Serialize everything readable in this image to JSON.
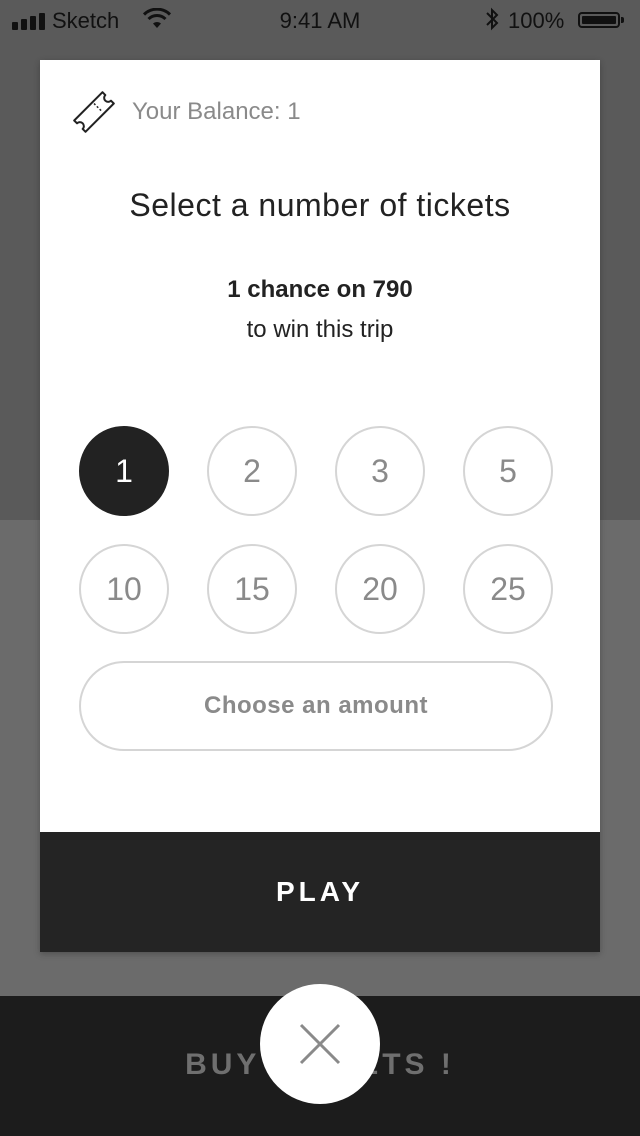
{
  "status_bar": {
    "carrier": "Sketch",
    "time": "9:41 AM",
    "battery": "100%"
  },
  "background": {
    "cta_label": "BUY TICKETS !"
  },
  "modal": {
    "balance_label": "Your Balance: 1",
    "title": "Select a number of tickets",
    "chance_text": "1 chance on 790",
    "chance_subtext": "to win this trip",
    "ticket_options": [
      "1",
      "2",
      "3",
      "5",
      "10",
      "15",
      "20",
      "25"
    ],
    "selected_option": "1",
    "custom_amount_label": "Choose an amount",
    "play_label": "PLAY"
  },
  "icons": {
    "ticket": "ticket-icon",
    "close": "close-icon",
    "wifi": "wifi-icon",
    "bluetooth": "bluetooth-icon",
    "battery": "battery-icon",
    "signal": "signal-icon"
  },
  "colors": {
    "dark": "#222222",
    "muted_text": "#8a8a8a",
    "border": "#d5d5d5",
    "overlay": "#5a5a5a"
  }
}
